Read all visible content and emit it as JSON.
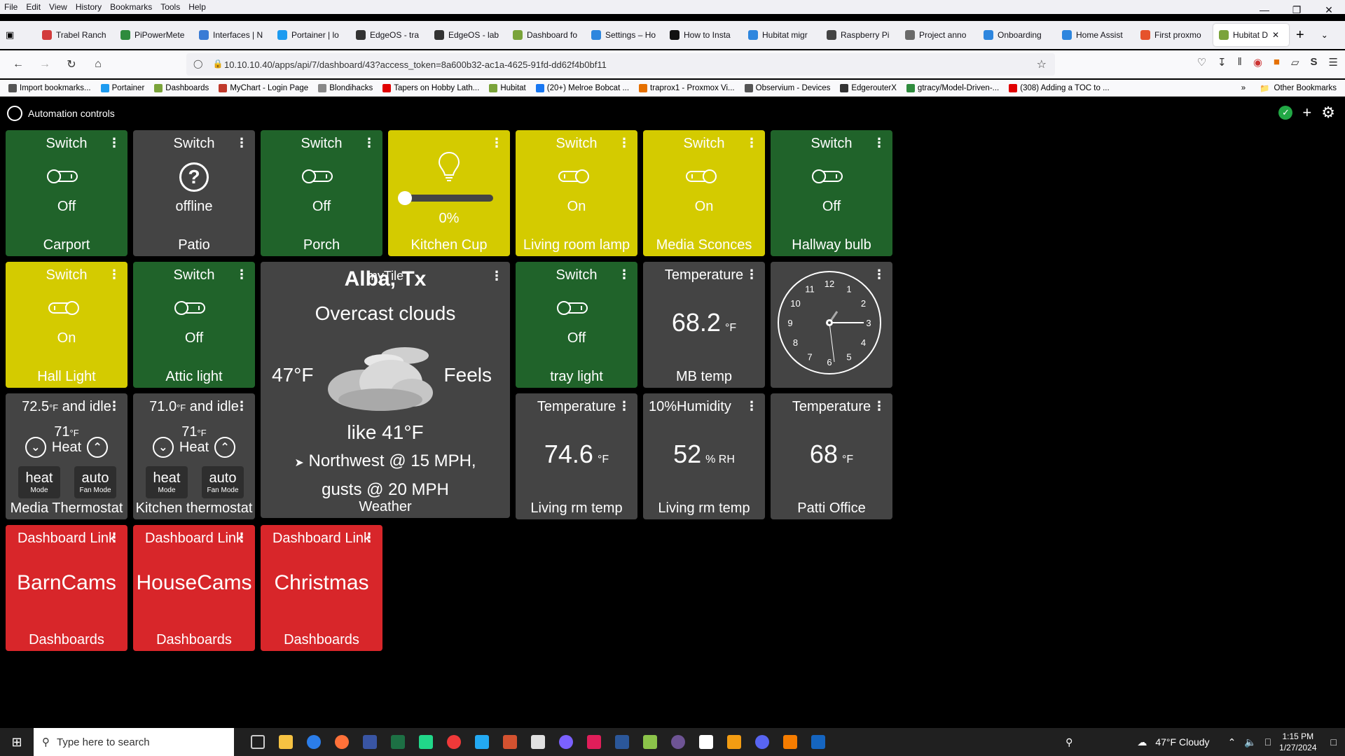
{
  "browser": {
    "menu": [
      "File",
      "Edit",
      "View",
      "History",
      "Bookmarks",
      "Tools",
      "Help"
    ],
    "tabs": [
      {
        "label": "Trabel Ranch",
        "color": "#d23c3c"
      },
      {
        "label": "PiPowerMete",
        "color": "#2e8b3d"
      },
      {
        "label": "Interfaces | N",
        "color": "#3a7bd5"
      },
      {
        "label": "Portainer | lo",
        "color": "#1d9bf0"
      },
      {
        "label": "EdgeOS - tra",
        "color": "#333333"
      },
      {
        "label": "EdgeOS - lab",
        "color": "#333333"
      },
      {
        "label": "Dashboard fo",
        "color": "#7aa33a"
      },
      {
        "label": "Settings – Ho",
        "color": "#2e86de"
      },
      {
        "label": "How to Insta",
        "color": "#111111"
      },
      {
        "label": "Hubitat migr",
        "color": "#2e86de"
      },
      {
        "label": "Raspberry Pi",
        "color": "#444444"
      },
      {
        "label": "Project anno",
        "color": "#6a6a6a"
      },
      {
        "label": "Onboarding",
        "color": "#2e86de"
      },
      {
        "label": "Home Assist",
        "color": "#2e86de"
      },
      {
        "label": "First proxmo",
        "color": "#e6522c"
      },
      {
        "label": "Hubitat D",
        "color": "#7aa33a",
        "active": true
      }
    ],
    "url": "10.10.10.40/apps/api/7/dashboard/43?access_token=8a600b32-ac1a-4625-91fd-dd62f4b0bf11",
    "bookmarks": [
      {
        "label": "Import bookmarks...",
        "color": "#555"
      },
      {
        "label": "Portainer",
        "color": "#1d9bf0"
      },
      {
        "label": "Dashboards",
        "color": "#7aa33a"
      },
      {
        "label": "MyChart - Login Page",
        "color": "#c0392b"
      },
      {
        "label": "Blondihacks",
        "color": "#888"
      },
      {
        "label": "Tapers on Hobby Lath...",
        "color": "#e00000"
      },
      {
        "label": "Hubitat",
        "color": "#7aa33a"
      },
      {
        "label": "(20+) Melroe Bobcat ...",
        "color": "#1877f2"
      },
      {
        "label": "traprox1 - Proxmox Vi...",
        "color": "#e57000"
      },
      {
        "label": "Observium - Devices",
        "color": "#555"
      },
      {
        "label": "EdgerouterX",
        "color": "#333"
      },
      {
        "label": "gtracy/Model-Driven-...",
        "color": "#2e8b3d"
      },
      {
        "label": "(308) Adding a TOC to ...",
        "color": "#e00000"
      }
    ],
    "other_bookmarks": "Other Bookmarks"
  },
  "app": {
    "title": "Automation controls"
  },
  "tiles": {
    "carport": {
      "title": "Switch",
      "state": "Off",
      "name": "Carport"
    },
    "patio": {
      "title": "Switch",
      "state": "offline",
      "name": "Patio"
    },
    "porch": {
      "title": "Switch",
      "state": "Off",
      "name": "Porch"
    },
    "kitchen_cup": {
      "level": "0%",
      "name": "Kitchen Cup"
    },
    "living_room_lamp": {
      "title": "Switch",
      "state": "On",
      "name": "Living room lamp"
    },
    "media_sconces": {
      "title": "Switch",
      "state": "On",
      "name": "Media Sconces"
    },
    "hallway_bulb": {
      "title": "Switch",
      "state": "Off",
      "name": "Hallway bulb"
    },
    "hall_light": {
      "title": "Switch",
      "state": "On",
      "name": "Hall Light"
    },
    "attic_light": {
      "title": "Switch",
      "state": "Off",
      "name": "Attic light"
    },
    "weather": {
      "tag": "myTile",
      "city": "Alba, Tx",
      "condition": "Overcast clouds",
      "temp": "47°F",
      "feels_a": "Feels",
      "feels_b": "like 41°F",
      "wind_a": "Northwest @ 15 MPH,",
      "wind_b": "gusts @ 20 MPH",
      "name": "Weather"
    },
    "tray_light": {
      "title": "Switch",
      "state": "Off",
      "name": "tray light"
    },
    "mb_temp": {
      "title": "Temperature",
      "value": "68.2",
      "unit": "°F",
      "name": "MB temp"
    },
    "clock": {
      "numbers": [
        "12",
        "1",
        "2",
        "3",
        "4",
        "5",
        "6",
        "7",
        "8",
        "9",
        "10",
        "11"
      ]
    },
    "media_thermostat": {
      "title_temp": "72.5",
      "title_unit": "°F",
      "title_rest": " and idle",
      "setpoint": "71",
      "setpoint_unit": "°F",
      "mode_label": "Heat",
      "mode": "heat",
      "mode_caption": "Mode",
      "fan": "auto",
      "fan_caption": "Fan Mode",
      "name": "Media Thermostat"
    },
    "kitchen_thermostat": {
      "title_temp": "71.0",
      "title_unit": "°F",
      "title_rest": " and idle",
      "setpoint": "71",
      "setpoint_unit": "°F",
      "mode_label": "Heat",
      "mode": "heat",
      "mode_caption": "Mode",
      "fan": "auto",
      "fan_caption": "Fan Mode",
      "name": "Kitchen thermostat"
    },
    "living_rm_temp": {
      "title": "Temperature",
      "value": "74.6",
      "unit": "°F",
      "name": "Living rm temp"
    },
    "living_rm_humidity": {
      "title": "10%Humidity",
      "value": "52",
      "unit": "% RH",
      "name": "Living rm temp"
    },
    "patti_office": {
      "title": "Temperature",
      "value": "68",
      "unit": "°F",
      "name": "Patti Office"
    },
    "barncams": {
      "title": "Dashboard Link",
      "label": "BarnCams",
      "name": "Dashboards"
    },
    "housecams": {
      "title": "Dashboard Link",
      "label": "HouseCams",
      "name": "Dashboards"
    },
    "christmas": {
      "title": "Dashboard Link",
      "label": "Christmas",
      "name": "Dashboards"
    }
  },
  "taskbar": {
    "search_placeholder": "Type here to search",
    "weather": "47°F  Cloudy",
    "time": "1:15 PM",
    "date": "1/27/2024"
  },
  "colors": {
    "switch_off": "#20632a",
    "switch_on": "#d4cb00",
    "neutral": "#444444",
    "link": "#d8262a"
  }
}
